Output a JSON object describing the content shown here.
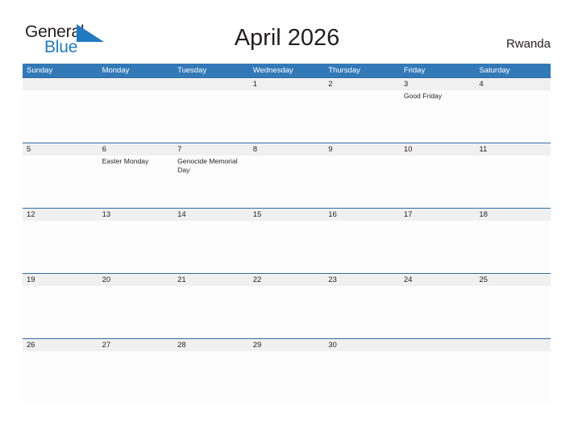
{
  "brand": {
    "name_part1": "General",
    "name_part2": "Blue",
    "flag_icon": "blue-triangle-flag"
  },
  "header": {
    "title": "April 2026",
    "country": "Rwanda"
  },
  "colors": {
    "header_blue": "#3279b8",
    "row_border_blue": "#2e6da4",
    "number_band_gray": "#f0f0f0",
    "brand_blue": "#1f7bc1",
    "text_dark": "#231f20"
  },
  "calendar": {
    "month": "April",
    "year": "2026",
    "weekdays": [
      "Sunday",
      "Monday",
      "Tuesday",
      "Wednesday",
      "Thursday",
      "Friday",
      "Saturday"
    ],
    "weeks": [
      [
        {
          "day": "",
          "events": []
        },
        {
          "day": "",
          "events": []
        },
        {
          "day": "",
          "events": []
        },
        {
          "day": "1",
          "events": []
        },
        {
          "day": "2",
          "events": []
        },
        {
          "day": "3",
          "events": [
            "Good Friday"
          ]
        },
        {
          "day": "4",
          "events": []
        }
      ],
      [
        {
          "day": "5",
          "events": []
        },
        {
          "day": "6",
          "events": [
            "Easter Monday"
          ]
        },
        {
          "day": "7",
          "events": [
            "Genocide Memorial Day"
          ]
        },
        {
          "day": "8",
          "events": []
        },
        {
          "day": "9",
          "events": []
        },
        {
          "day": "10",
          "events": []
        },
        {
          "day": "11",
          "events": []
        }
      ],
      [
        {
          "day": "12",
          "events": []
        },
        {
          "day": "13",
          "events": []
        },
        {
          "day": "14",
          "events": []
        },
        {
          "day": "15",
          "events": []
        },
        {
          "day": "16",
          "events": []
        },
        {
          "day": "17",
          "events": []
        },
        {
          "day": "18",
          "events": []
        }
      ],
      [
        {
          "day": "19",
          "events": []
        },
        {
          "day": "20",
          "events": []
        },
        {
          "day": "21",
          "events": []
        },
        {
          "day": "22",
          "events": []
        },
        {
          "day": "23",
          "events": []
        },
        {
          "day": "24",
          "events": []
        },
        {
          "day": "25",
          "events": []
        }
      ],
      [
        {
          "day": "26",
          "events": []
        },
        {
          "day": "27",
          "events": []
        },
        {
          "day": "28",
          "events": []
        },
        {
          "day": "29",
          "events": []
        },
        {
          "day": "30",
          "events": []
        },
        {
          "day": "",
          "events": []
        },
        {
          "day": "",
          "events": []
        }
      ]
    ]
  }
}
